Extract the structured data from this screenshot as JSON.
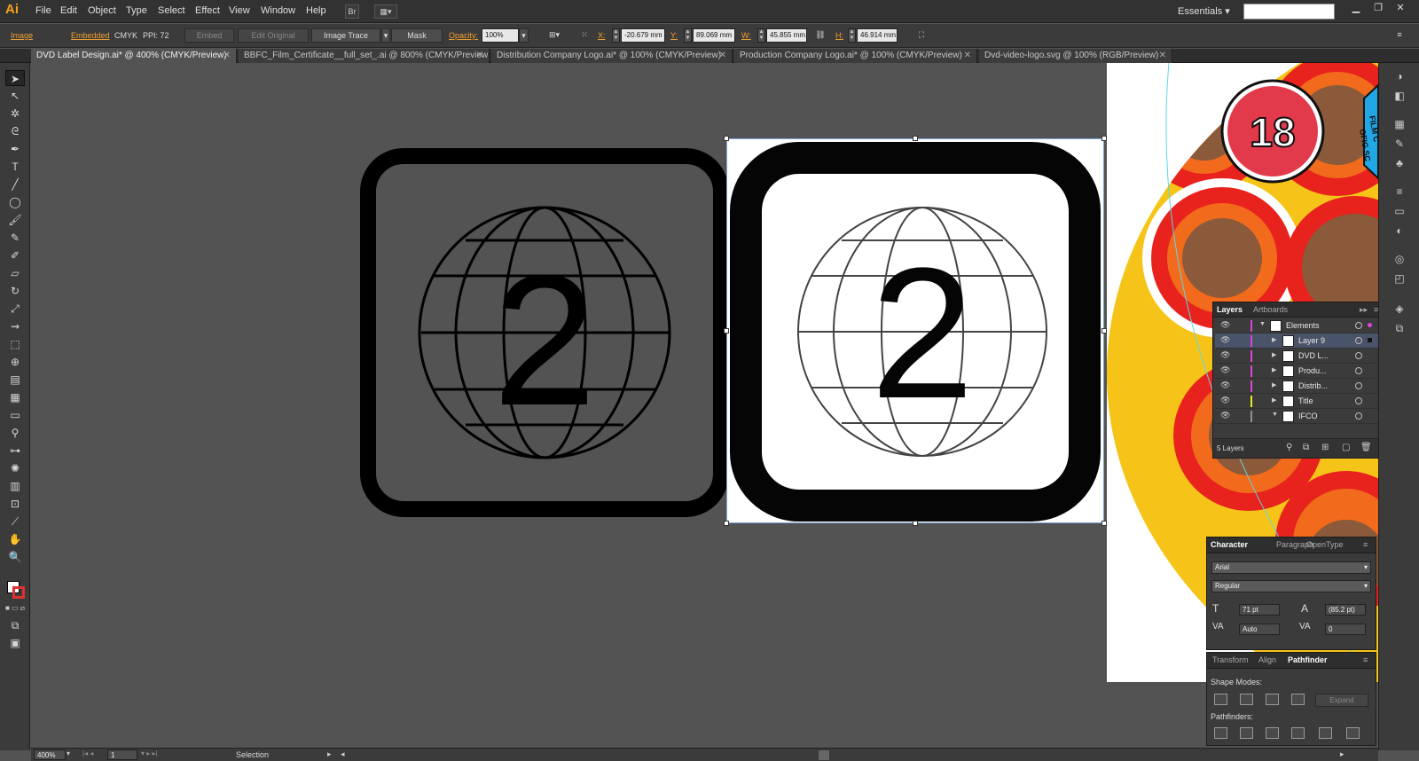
{
  "app": {
    "logo": "Ai"
  },
  "menu": {
    "items": [
      "File",
      "Edit",
      "Object",
      "Type",
      "Select",
      "Effect",
      "View",
      "Window",
      "Help"
    ],
    "bridge": "Br"
  },
  "workspace": {
    "label": "Essentials",
    "search_placeholder": ""
  },
  "controlbar": {
    "object_type": "Image",
    "embedded": "Embedded",
    "color_mode": "CMYK",
    "ppi": "PPI: 72",
    "embed_btn": "Embed",
    "edit_original_btn": "Edit Original",
    "image_trace_btn": "Image Trace",
    "mask_btn": "Mask",
    "opacity_label": "Opacity:",
    "opacity_value": "100%",
    "x_label": "X:",
    "x_value": "-20.679 mm",
    "y_label": "Y:",
    "y_value": "89.069 mm",
    "w_label": "W:",
    "w_value": "45.855 mm",
    "h_label": "H:",
    "h_value": "46.914 mm"
  },
  "tabs": [
    {
      "label": "DVD Label Design.ai* @ 400% (CMYK/Preview)",
      "active": true
    },
    {
      "label": "BBFC_Film_Certificate__full_set_.ai @ 800% (CMYK/Preview)",
      "active": false
    },
    {
      "label": "Distribution Company Logo.ai* @ 100% (CMYK/Preview)",
      "active": false
    },
    {
      "label": "Production Company Logo.ai* @ 100% (CMYK/Preview)",
      "active": false
    },
    {
      "label": "Dvd-video-logo.svg @ 100% (RGB/Preview)",
      "active": false
    }
  ],
  "artwork": {
    "numeral_left": "2",
    "numeral_right": "2",
    "badge": "18",
    "badge_text": "FILM C",
    "badge_text2": "OFIG SC"
  },
  "layers_panel": {
    "tabs": [
      "Layers",
      "Artboards"
    ],
    "rows": [
      {
        "name": "Elements",
        "color": "#d946d9",
        "indent": 0,
        "expanded": true,
        "selected": false
      },
      {
        "name": "Layer 9",
        "color": "#d946d9",
        "indent": 1,
        "expanded": false,
        "selected": true
      },
      {
        "name": "DVD L...",
        "color": "#d946d9",
        "indent": 1,
        "expanded": false,
        "selected": false
      },
      {
        "name": "Produ...",
        "color": "#d946d9",
        "indent": 1,
        "expanded": false,
        "selected": false
      },
      {
        "name": "Distrib...",
        "color": "#d946d9",
        "indent": 1,
        "expanded": false,
        "selected": false
      },
      {
        "name": "Title",
        "color": "#e8e820",
        "indent": 1,
        "expanded": false,
        "selected": false
      },
      {
        "name": "IFCO",
        "color": "#909090",
        "indent": 1,
        "expanded": true,
        "selected": false
      }
    ],
    "footer": "5 Layers"
  },
  "character_panel": {
    "tabs": [
      "Character",
      "Paragraph",
      "OpenType"
    ],
    "font": "Arial",
    "style": "Regular",
    "size": "71 pt",
    "leading": "(85.2 pt)",
    "kerning": "Auto",
    "tracking": "0"
  },
  "pathfinder_panel": {
    "tabs": [
      "Transform",
      "Align",
      "Pathfinder"
    ],
    "shape_modes_label": "Shape Modes:",
    "expand_btn": "Expand",
    "pathfinders_label": "Pathfinders:"
  },
  "status": {
    "zoom": "400%",
    "page": "1",
    "tool": "Selection"
  }
}
